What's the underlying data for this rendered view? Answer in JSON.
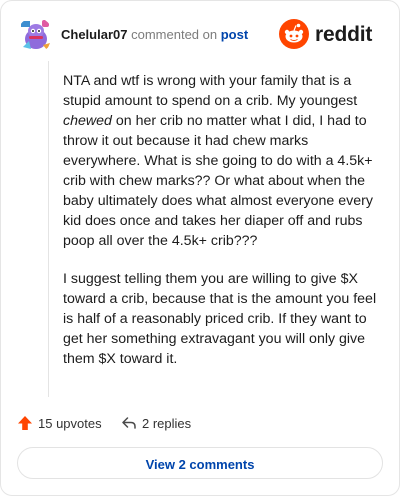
{
  "comment": {
    "author": "Chelular07",
    "action_text": "commented on",
    "post_link": "post",
    "brand": "reddit",
    "paragraph_1a": "NTA and wtf is wrong with your family that is a stupid amount to spend on a crib. My youngest ",
    "paragraph_1_em": "chewed",
    "paragraph_1b": " on her crib no matter what I did, I had to throw it out because it had chew marks everywhere. What is she going to do with a 4.5k+ crib with chew marks?? Or what about when the baby ultimately does what almost everyone every kid does once and takes her diaper off and rubs poop all over the 4.5k+ crib???",
    "paragraph_2": "I suggest telling them you are willing to give $X toward a crib, because that is the amount you feel is half of a reasonably priced crib. If they want to get her something extravagant you will only give them $X toward it."
  },
  "actions": {
    "upvotes": "15 upvotes",
    "replies": "2 replies",
    "view_comments": "View 2 comments"
  },
  "colors": {
    "upvote": "#ff4500",
    "link": "#0045ac",
    "brand": "#ff4500"
  },
  "icons": [
    "avatar",
    "reddit-logo-icon",
    "upvote-arrow-icon",
    "reply-icon"
  ]
}
